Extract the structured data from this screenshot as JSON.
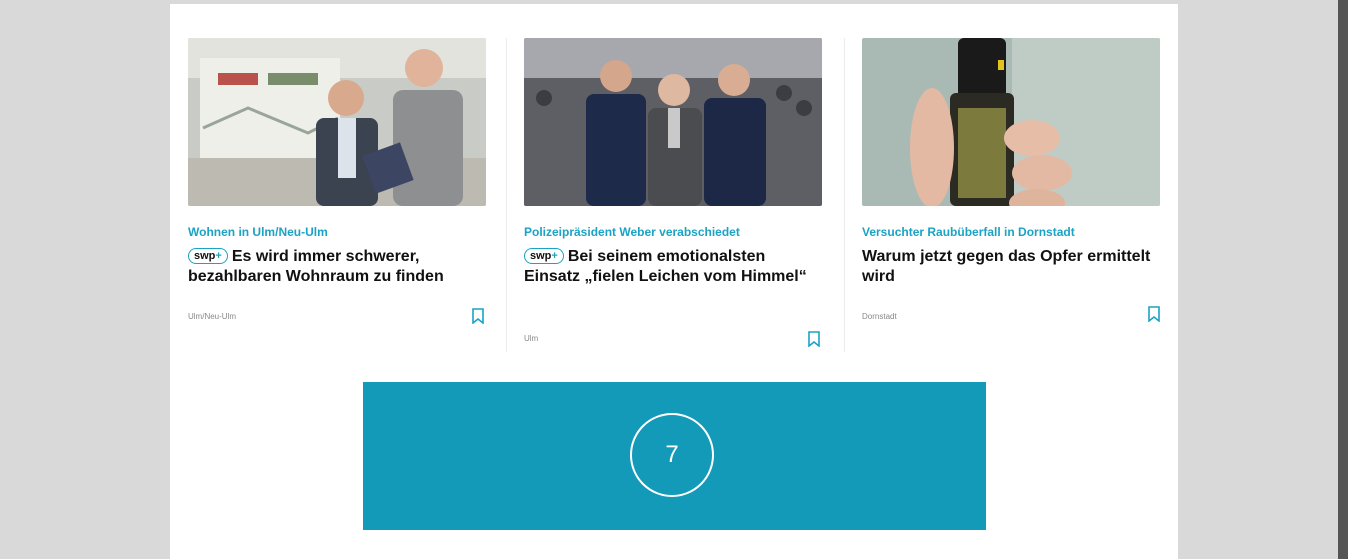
{
  "articles": [
    {
      "kicker": "Wohnen in Ulm/Neu-Ulm",
      "badge": "swp",
      "badge_plus": "+",
      "headline": "Es wird immer schwerer, bezahlbaren Wohnraum zu finden",
      "location": "Ulm/Neu-Ulm",
      "image_icon": "photo-two-men-with-plans"
    },
    {
      "kicker": "Polizeipräsident Weber verabschiedet",
      "badge": "swp",
      "badge_plus": "+",
      "headline": "Bei seinem emotionalsten Einsatz „fielen Leichen vom Himmel“",
      "location": "Ulm",
      "image_icon": "photo-police-officers"
    },
    {
      "kicker": "Versuchter Raubüberfall in Dornstadt",
      "headline": "Warum jetzt gegen das Opfer ermittelt wird",
      "location": "Dornstadt",
      "image_icon": "photo-pepper-spray"
    }
  ],
  "ad": {
    "number": "7",
    "color": "#139ab8"
  },
  "colors": {
    "accent": "#1aa3c4",
    "background": "#d9d9d9"
  }
}
